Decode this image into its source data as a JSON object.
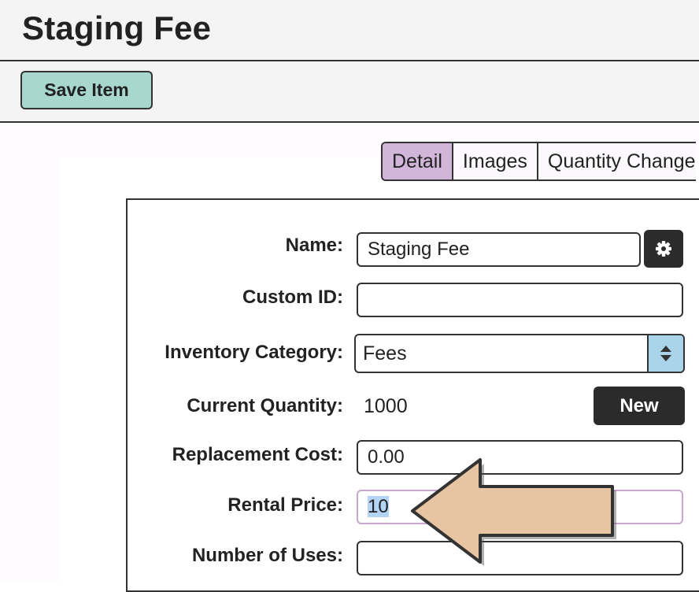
{
  "page": {
    "title": "Staging Fee"
  },
  "toolbar": {
    "save_label": "Save Item"
  },
  "tabs": [
    {
      "label": "Detail",
      "active": true
    },
    {
      "label": "Images",
      "active": false
    },
    {
      "label": "Quantity Change",
      "active": false
    }
  ],
  "form": {
    "name": {
      "label": "Name:",
      "value": "Staging Fee"
    },
    "custom_id": {
      "label": "Custom ID:",
      "value": ""
    },
    "inventory_category": {
      "label": "Inventory Category:",
      "value": "Fees"
    },
    "current_quantity": {
      "label": "Current Quantity:",
      "value": "1000",
      "new_label": "New"
    },
    "replacement_cost": {
      "label": "Replacement Cost:",
      "value": "0.00"
    },
    "rental_price": {
      "label": "Rental Price:",
      "value": "10"
    },
    "number_of_uses": {
      "label": "Number of Uses:",
      "value": ""
    }
  },
  "icons": {
    "settings": "gear-icon",
    "select": "up-down-arrows-icon",
    "annotation": "left-arrow-callout-icon"
  },
  "colors": {
    "save_button": "#a7d7cd",
    "active_tab": "#d2b6d9",
    "dark_button": "#2b2b2b",
    "select_arrow_bg": "#a9d4ea",
    "arrow_fill": "#e8c5a2",
    "focused_field_border": "#c8a6cf"
  }
}
